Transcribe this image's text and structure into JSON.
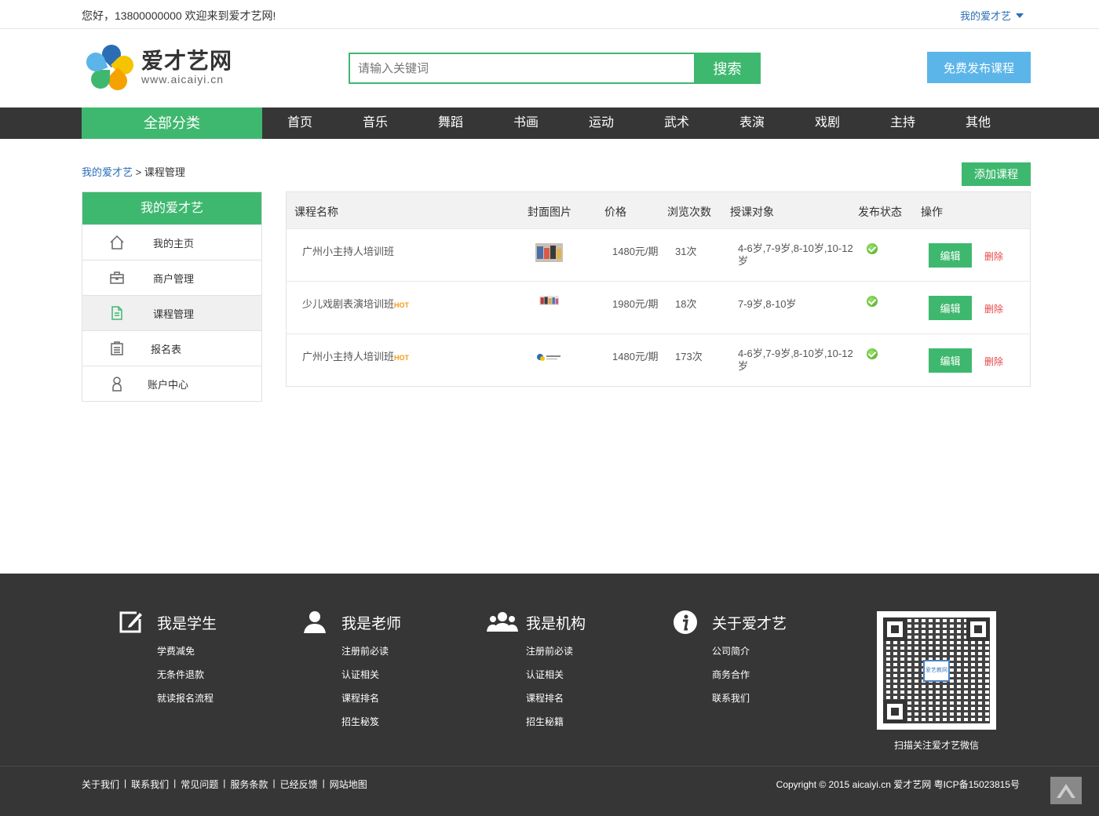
{
  "topbar": {
    "welcome": "您好，13800000000 欢迎来到爱才艺网!",
    "my": "我的爱才艺"
  },
  "logo": {
    "title": "爱才艺网",
    "sub": "www.aicaiyi.cn"
  },
  "search": {
    "placeholder": "请输入关键词",
    "button": "搜索"
  },
  "publish": "免费发布课程",
  "nav": {
    "all": "全部分类",
    "items": [
      "首页",
      "音乐",
      "舞蹈",
      "书画",
      "运动",
      "武术",
      "表演",
      "戏剧",
      "主持",
      "其他"
    ]
  },
  "breadcrumb": {
    "root": "我的爱才艺",
    "sep": ">",
    "current": "课程管理"
  },
  "add_course": "添加课程",
  "sidebar": {
    "head": "我的爱才艺",
    "items": [
      {
        "label": "我的主页",
        "icon": "home-icon"
      },
      {
        "label": "商户管理",
        "icon": "briefcase-icon"
      },
      {
        "label": "课程管理",
        "icon": "document-icon"
      },
      {
        "label": "报名表",
        "icon": "clipboard-icon"
      },
      {
        "label": "账户中心",
        "icon": "user-icon"
      }
    ]
  },
  "table": {
    "headers": [
      "课程名称",
      "封面图片",
      "价格",
      "浏览次数",
      "授课对象",
      "发布状态",
      "操作"
    ],
    "rows": [
      {
        "name": "广州小主持人培训班",
        "hot": "",
        "price": "1480元/期",
        "views": "31次",
        "target": "4-6岁,7-9岁,8-10岁,10-12",
        "target2": "岁"
      },
      {
        "name": "少儿戏剧表演培训班",
        "hot": "HOT",
        "price": "1980元/期",
        "views": "18次",
        "target": "7-9岁,8-10岁",
        "target2": ""
      },
      {
        "name": "广州小主持人培训班",
        "hot": "HOT",
        "price": "1480元/期",
        "views": "173次",
        "target": "4-6岁,7-9岁,8-10岁,10-12",
        "target2": "岁"
      }
    ],
    "edit": "编辑",
    "delete": "删除"
  },
  "footer": {
    "cols": [
      {
        "title": "我是学生",
        "icon": "edit-icon",
        "links": [
          "学费减免",
          "无条件退款",
          "就读报名流程"
        ]
      },
      {
        "title": "我是老师",
        "icon": "person-icon",
        "links": [
          "注册前必读",
          "认证相关",
          "课程排名",
          "招生秘笈"
        ]
      },
      {
        "title": "我是机构",
        "icon": "group-icon",
        "links": [
          "注册前必读",
          "认证相关",
          "课程排名",
          "招生秘籍"
        ]
      },
      {
        "title": "关于爱才艺",
        "icon": "info-icon",
        "links": [
          "公司简介",
          "商务合作",
          "联系我们"
        ]
      }
    ],
    "qr_badge": "爱艺教网",
    "qr_caption": "扫描关注爱才艺微信",
    "links": [
      "关于我们",
      "联系我们",
      "常见问题",
      "服务条款",
      "已经反馈",
      "网站地图"
    ],
    "copyright": "Copyright © 2015 aicaiyi.cn 爱才艺网 粤ICP备15023815号"
  },
  "colors": {
    "green": "#3fb86f",
    "blue": "#5bb5e9",
    "dark": "#363636",
    "link": "#2a6db5",
    "delete": "#e84646"
  }
}
